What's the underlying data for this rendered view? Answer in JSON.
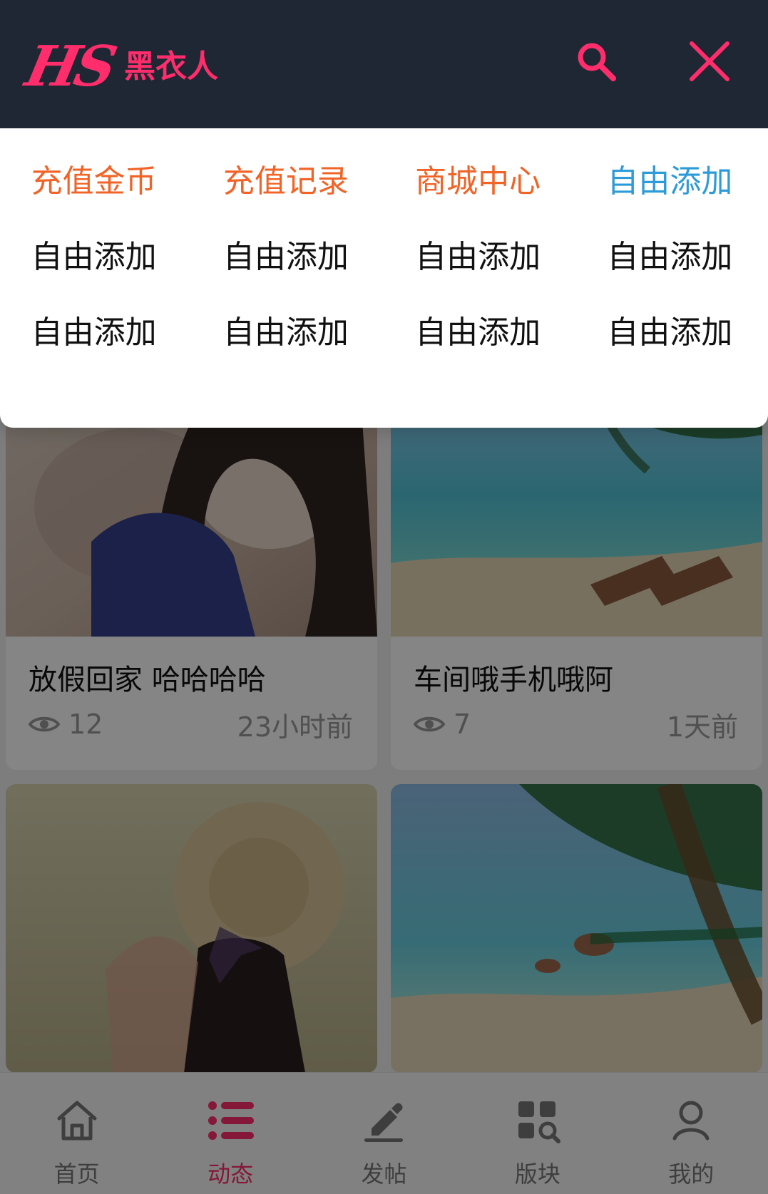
{
  "header": {
    "brand_mark": "HS",
    "brand_text": "黑衣人"
  },
  "menu": {
    "items": [
      {
        "label": "充值金币",
        "accent": "orange"
      },
      {
        "label": "充值记录",
        "accent": "orange"
      },
      {
        "label": "商城中心",
        "accent": "orange"
      },
      {
        "label": "自由添加",
        "accent": "blue"
      },
      {
        "label": "自由添加",
        "accent": "none"
      },
      {
        "label": "自由添加",
        "accent": "none"
      },
      {
        "label": "自由添加",
        "accent": "none"
      },
      {
        "label": "自由添加",
        "accent": "none"
      },
      {
        "label": "自由添加",
        "accent": "none"
      },
      {
        "label": "自由添加",
        "accent": "none"
      },
      {
        "label": "自由添加",
        "accent": "none"
      },
      {
        "label": "自由添加",
        "accent": "none"
      }
    ]
  },
  "posts": [
    {
      "title": "放假回家 哈哈哈哈",
      "views": "12",
      "time": "23小时前"
    },
    {
      "title": "车间哦手机哦阿",
      "views": "7",
      "time": "1天前"
    }
  ],
  "tabbar": {
    "items": [
      {
        "label": "首页",
        "icon": "home-icon",
        "active": false
      },
      {
        "label": "动态",
        "icon": "list-icon",
        "active": true
      },
      {
        "label": "发帖",
        "icon": "edit-icon",
        "active": false
      },
      {
        "label": "版块",
        "icon": "grid-search-icon",
        "active": false
      },
      {
        "label": "我的",
        "icon": "user-icon",
        "active": false
      }
    ]
  },
  "colors": {
    "header_bg": "#1f2734",
    "brand": "#ff2d6b",
    "menu_orange": "#f06428",
    "menu_blue": "#2e9bd9"
  }
}
